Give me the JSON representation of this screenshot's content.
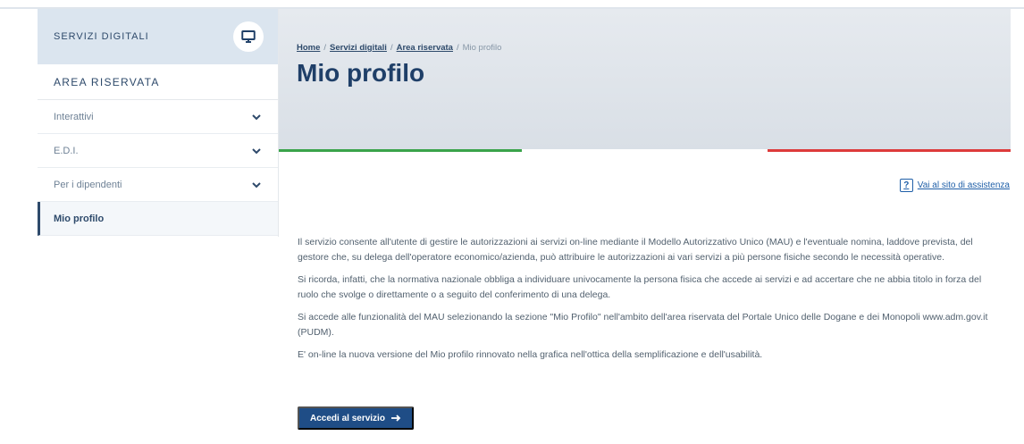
{
  "sidebar": {
    "header_title": "SERVIZI DIGITALI",
    "header_icon": "monitor-icon",
    "area_title": "AREA RISERVATA",
    "items": [
      {
        "label": "Interattivi",
        "icon": "chevron-down-icon"
      },
      {
        "label": "E.D.I.",
        "icon": "chevron-down-icon"
      },
      {
        "label": "Per i dipendenti",
        "icon": "chevron-down-icon"
      },
      {
        "label": "Mio profilo",
        "active": true
      }
    ]
  },
  "breadcrumb": {
    "items": [
      "Home",
      "Servizi digitali",
      "Area riservata"
    ],
    "separator": "/",
    "current": "Mio profilo"
  },
  "page": {
    "title": "Mio profilo"
  },
  "help": {
    "icon_text": "?",
    "label": "Vai al sito di assistenza"
  },
  "content": {
    "paragraphs": [
      "Il servizio consente all'utente di gestire le autorizzazioni ai servizi on-line mediante il Modello Autorizzativo Unico (MAU) e l'eventuale nomina, laddove prevista, del gestore che, su delega dell'operatore economico/azienda, può attribuire le autorizzazioni ai vari servizi a più persone fisiche secondo le necessità operative.",
      "Si ricorda, infatti, che la normativa nazionale obbliga a individuare univocamente la persona fisica che accede ai servizi e ad accertare che ne abbia titolo in forza del ruolo che svolge o direttamente o a seguito del conferimento di una delega.",
      "Si accede alle funzionalità del MAU selezionando la sezione \"Mio Profilo\" nell'ambito dell'area riservata del Portale Unico delle Dogane e dei Monopoli www.adm.gov.it (PUDM).",
      "E' on-line la nuova versione del Mio profilo rinnovato nella grafica nell'ottica della semplificazione e dell'usabilità."
    ],
    "cta_label": "Accedi al servizio",
    "cta_icon": "arrow-right-icon"
  },
  "colors": {
    "primary": "#1f4d86",
    "flag_green": "#3aa34a",
    "flag_red": "#dd3b3b",
    "hero_bg": "#dde3e9"
  }
}
